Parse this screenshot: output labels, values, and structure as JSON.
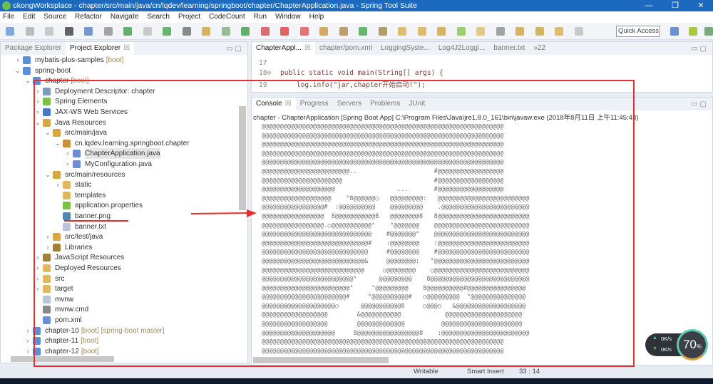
{
  "window": {
    "title": "okongWorksplace - chapter/src/main/java/cn/lqdev/learning/springboot/chapter/ChapterApplication.java - Spring Tool Suite",
    "minimize": "—",
    "maximize": "❐",
    "close": "✕"
  },
  "menu": [
    "File",
    "Edit",
    "Source",
    "Refactor",
    "Navigate",
    "Search",
    "Project",
    "CodeCount",
    "Run",
    "Window",
    "Help"
  ],
  "toolbar": {
    "quick_access_placeholder": "Quick Access"
  },
  "explorer": {
    "tabs": [
      {
        "label": "Package Explorer"
      },
      {
        "label": "Project Explorer",
        "close": "☒"
      }
    ],
    "items": [
      {
        "level": 1,
        "chev": ">",
        "label": "mybatis-plus-samples",
        "dec": "[boot]",
        "icon": "spring-project-icon",
        "color": "#5b8fd6"
      },
      {
        "level": 1,
        "chev": "v",
        "label": "spring-boot",
        "dec": "",
        "icon": "working-set-icon",
        "color": "#5b8fd6"
      },
      {
        "level": 2,
        "chev": "v",
        "label": "chapter",
        "dec": "[boot]",
        "icon": "spring-project-icon",
        "color": "#5b8fd6"
      },
      {
        "level": 3,
        "chev": ">",
        "label": "Deployment Descriptor: chapter",
        "dec": "",
        "icon": "deployment-descriptor-icon",
        "color": "#7a9bbf"
      },
      {
        "level": 3,
        "chev": ">",
        "label": "Spring Elements",
        "dec": "",
        "icon": "spring-leaf-icon",
        "color": "#7cc242"
      },
      {
        "level": 3,
        "chev": ">",
        "label": "JAX-WS Web Services",
        "dec": "",
        "icon": "web-services-icon",
        "color": "#4a78c0"
      },
      {
        "level": 3,
        "chev": "v",
        "label": "Java Resources",
        "dec": "",
        "icon": "java-resources-icon",
        "color": "#d8a840"
      },
      {
        "level": 4,
        "chev": "v",
        "label": "src/main/java",
        "dec": "",
        "icon": "source-folder-icon",
        "color": "#d8a840"
      },
      {
        "level": 5,
        "chev": "v",
        "label": "cn.lqdev.learning.springboot.chapter",
        "dec": "",
        "icon": "package-icon",
        "color": "#c89038"
      },
      {
        "level": 6,
        "chev": ">",
        "label": "ChapterApplication.java",
        "dec": "",
        "icon": "java-file-icon",
        "color": "#6b8fd0",
        "selected": true
      },
      {
        "level": 6,
        "chev": ">",
        "label": "MyConfiguration.java",
        "dec": "",
        "icon": "java-file-icon",
        "color": "#6b8fd0"
      },
      {
        "level": 4,
        "chev": "v",
        "label": "src/main/resources",
        "dec": "",
        "icon": "source-folder-icon",
        "color": "#d8a840"
      },
      {
        "level": 5,
        "chev": ">",
        "label": "static",
        "dec": "",
        "icon": "folder-icon",
        "color": "#e0b860"
      },
      {
        "level": 5,
        "chev": "",
        "label": "templates",
        "dec": "",
        "icon": "folder-icon",
        "color": "#e0b860"
      },
      {
        "level": 5,
        "chev": "",
        "label": "application.properties",
        "dec": "",
        "icon": "spring-leaf-icon",
        "color": "#7cc242"
      },
      {
        "level": 5,
        "chev": "",
        "label": "banner.png",
        "dec": "",
        "icon": "image-file-icon",
        "color": "#4a8ab0"
      },
      {
        "level": 5,
        "chev": "",
        "label": "banner.txt",
        "dec": "",
        "icon": "text-file-icon",
        "color": "#b8c4d8"
      },
      {
        "level": 4,
        "chev": ">",
        "label": "src/test/java",
        "dec": "",
        "icon": "source-folder-icon",
        "color": "#d8a840"
      },
      {
        "level": 4,
        "chev": ">",
        "label": "Libraries",
        "dec": "",
        "icon": "libraries-icon",
        "color": "#a0803a"
      },
      {
        "level": 3,
        "chev": ">",
        "label": "JavaScript Resources",
        "dec": "",
        "icon": "libraries-icon",
        "color": "#a0803a"
      },
      {
        "level": 3,
        "chev": ">",
        "label": "Deployed Resources",
        "dec": "",
        "icon": "deployed-resources-icon",
        "color": "#e0b860"
      },
      {
        "level": 3,
        "chev": ">",
        "label": "src",
        "dec": "",
        "icon": "folder-icon",
        "color": "#e0b860"
      },
      {
        "level": 3,
        "chev": ">",
        "label": "target",
        "dec": "",
        "icon": "folder-icon",
        "color": "#e0b860"
      },
      {
        "level": 3,
        "chev": "",
        "label": "mvnw",
        "dec": "",
        "icon": "text-file-icon",
        "color": "#b8c4d8"
      },
      {
        "level": 3,
        "chev": "",
        "label": "mvnw.cmd",
        "dec": "",
        "icon": "cmd-file-icon",
        "color": "#888"
      },
      {
        "level": 3,
        "chev": "",
        "label": "pom.xml",
        "dec": "",
        "icon": "maven-file-icon",
        "color": "#6b8fd0"
      },
      {
        "level": 2,
        "chev": ">",
        "label": "chapter-10",
        "dec": "[boot] [spring-boot master]",
        "icon": "spring-project-icon",
        "color": "#5b8fd6"
      },
      {
        "level": 2,
        "chev": ">",
        "label": "chapter-11",
        "dec": "[boot]",
        "icon": "spring-project-icon",
        "color": "#5b8fd6"
      },
      {
        "level": 2,
        "chev": ">",
        "label": "chapter-12",
        "dec": "[boot]",
        "icon": "spring-project-icon",
        "color": "#5b8fd6"
      }
    ]
  },
  "editor": {
    "tabs": [
      {
        "label": "ChapterAppl...",
        "close": "☒"
      },
      {
        "label": "chapter/pom.xml"
      },
      {
        "label": "LoggingSyste..."
      },
      {
        "label": "Log4J2Loggi..."
      },
      {
        "label": "banner.txt"
      },
      {
        "label": "»22"
      }
    ],
    "lines": [
      {
        "n": "17",
        "code": ""
      },
      {
        "n": "18⊖",
        "code": "public static void main(String[] args) {"
      },
      {
        "n": "19",
        "code": "    log.info(\"jar,chapter开始启动!\");"
      }
    ]
  },
  "console": {
    "tabs": [
      {
        "label": "Console",
        "close": "☒"
      },
      {
        "label": "Progress"
      },
      {
        "label": "Servers"
      },
      {
        "label": "Problems"
      },
      {
        "label": "JUnit"
      }
    ],
    "header": "chapter - ChapterApplication [Spring Boot App] C:\\Program Files\\Java\\jre1.8.0_161\\bin\\javaw.exe (2018年8月11日 上午11:45:43)",
    "output": [
      "@@@@@@@@@@@@@@@@@@@@@@@@@@@@@@@@@@@@@@@@@@@@@@@@@@@@@@@@@@@@@@@@@@",
      "@@@@@@@@@@@@@@@@@@@@@@@@@@@@@@@@@@@@@@@@@@@@@@@@@@@@@@@@@@@@@@@@@@",
      "@@@@@@@@@@@@@@@@@@@@@@@@@@@@@@@@@@@@@@@@@@@@@@@@@@@@@@@@@@@@@@@@@@",
      "@@@@@@@@@@@@@@@@@@@@@@@@@@@@@@@@@@@@@@@@@@@@@@@@@@@@@@@@@@@@@@@@@@",
      "@@@@@@@@@@@@@@@@@@@@@@@@@@@@@@@@@@@@@@@@@@@@@@@@@@@@@@@@@@@@@@@@@@",
      "@@@@@@@@@@@@@@@@@@@@@@@@..                     #@@@@@@@@@@@@@@@@@@",
      "@@@@@@@@@@@@@@@@@@@@@@                         #@@@@@@@@@@@@@@@@@@",
      "@@@@@@@@@@@@@@@@@@@@                 ...       #@@@@@@@@@@@@@@@@@@",
      "@@@@@@@@@@@@@@@@@@@    °8@@@@@@○   @@@@@@@@@:   @@@@@@@@@@@@@@@@@@@@@@@@@",
      "@@@@@@@@@@@@@@@@@#  :@@@@@@@@@@    @@@@@@@@@    .@@@@@@@@@@@@@@@@@@@@@@@@",
      "@@@@@@@@@@@@@@@@@  8@@@@@@@@@@@8   @@@@@@@@8   8@@@@@@@@@@@@@@@@@@@@@@@@@",
      "@@@@@@@@@@@@@@@@@.○@@@@@@@@@@@°    °@@@@@@@    @@@@@@@@@@@@@@@@@@@@@@@@@@",
      "@@@@@@@@@@@@@@@@@@@@@@@@@@@@@@    #@@@@@@@°    @@@@@@@@@@@@@@@@@@@@@@@@@@",
      "@@@@@@@@@@@@@@@@@@@@@@@@@@@@@#    :@@@@@@@@    :@@@@@@@@@@@@@@@@@@@@@@@@@",
      "@@@@@@@@@@@@@@@@@@@@@@@@@@@@@     #@@@@@@@@    #@@@@@@@@@@@@@@@@@@@@@@@@@",
      "@@@@@@@@@@@@@@@@@@@@@@@@@@@@&     @@@@@@@@:   °@@@@@@@@@@@@@@@@@@@@@@@@@@",
      "@@@@@@@@@@@@@@@@@@@@@@@@@@@@     ○@@@@@@@@    ○@@@@@@@@@@@@@@@@@@@@@@@@@@",
      "@@@@@@@@@@@@@@@@@@@@@@@@@°      @@@@@@@@@    8@@@@@@@@@@@@@@@@@@@@@@@@@@@",
      "@@@@@@@@@@@@@@@@@@@@@@@@°     °@@@@@@@@@    8@@@@@@@@@@#@@@@@@@@@@@@@@@@",
      "@@@@@@@@@@@@@@@@@@@@@@@#     °@@@@@@@@@@#   ○@@@@@@@@@  °@@@@@@@@@@@@@@@",
      "@@@@@@@@@@@@@@@@@@@@○      @@@@@@@@@@@8     ○@@@○   &@@@@@@@@@@@@@@@@@@@",
      "@@@@@@@@@@@@@@@@@@        &@@@@@@@@@@@            @@@@@@@@@@@@@@@@@@@@@",
      "@@@@@@@@@@@@@@@@@@        @@@@@@@@@@@@@          @@@@@@@@@@@@@@@@@@@@@@",
      "@@@@@@@@@@@@@@@@@@@@     8@@@@@@@@@@@@@@@@@8    :@@@@@@@@@@@@@@@@@@@@@@@@",
      "@@@@@@@@@@@@@@@@@@@@@@@@@@@@@@@@@@@@@@@@@@@@@@@@@@@@@@@@@@@@@@@@@@",
      "@@@@@@@@@@@@@@@@@@@@@@@@@@@@@@@@@@@@@@@@@@@@@@@@@@@@@@@@@@@@@@@@@@"
    ]
  },
  "status": {
    "writable": "Writable",
    "insert_mode": "Smart Insert",
    "position": "33 : 14"
  },
  "network": {
    "upload": "0K/s",
    "download": "0K/s",
    "percent": "70",
    "unit": "%"
  },
  "colors": {
    "title_bar": "#1b6ac0",
    "annotation_red": "#e53030"
  }
}
